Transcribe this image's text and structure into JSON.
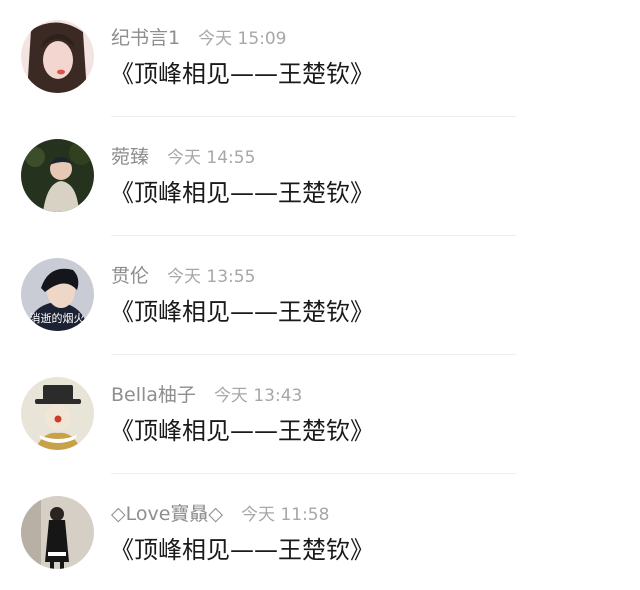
{
  "comments": [
    {
      "username": "纪书言1",
      "time": "今天 15:09",
      "text": "《顶峰相见——王楚钦》",
      "avatar_icon": "avatar-girl-photo",
      "avatar_colors": [
        "#f3dfdc",
        "#3b2a24"
      ]
    },
    {
      "username": "菀臻",
      "time": "今天 14:55",
      "text": "《顶峰相见——王楚钦》",
      "avatar_icon": "avatar-person-outdoor",
      "avatar_colors": [
        "#26331e",
        "#d8d2c4"
      ]
    },
    {
      "username": "贯伦",
      "time": "今天 13:55",
      "text": "《顶峰相见——王楚钦》",
      "avatar_icon": "avatar-boy-portrait",
      "avatar_colors": [
        "#c9ccd4",
        "#1c2233"
      ],
      "avatar_caption": "消逝的烟火"
    },
    {
      "username": "Bella柚子",
      "time": "今天 13:43",
      "text": "《顶峰相见——王楚钦》",
      "avatar_icon": "avatar-clown",
      "avatar_colors": [
        "#e8e4d8",
        "#2b2b2b"
      ]
    },
    {
      "username": "◇Love寶贔◇",
      "time": "今天 11:58",
      "text": "《顶峰相见——王楚钦》",
      "avatar_icon": "avatar-person-dark-room",
      "avatar_colors": [
        "#d5cfc6",
        "#161616"
      ]
    }
  ]
}
